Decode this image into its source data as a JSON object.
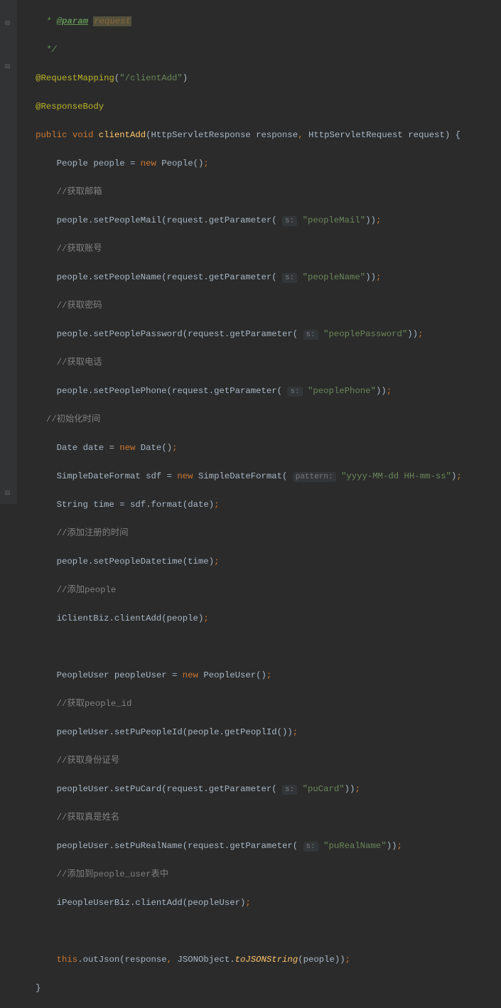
{
  "code": {
    "doc_star": " * ",
    "doc_param_tag": "@param",
    "doc_param_name": "request",
    "doc_close": " */",
    "ann_reqmap": "@RequestMapping",
    "ann_reqmap_val": "\"/clientAdd\"",
    "ann_respbody": "@ResponseBody",
    "kw_public": "public",
    "kw_void": "void",
    "kw_new": "new",
    "kw_this": "this",
    "fn_clientAdd": "clientAdd",
    "type_HttpServletResponse": "HttpServletResponse",
    "var_response": "response",
    "type_HttpServletRequest": "HttpServletRequest",
    "var_request": "request",
    "type_People": "People",
    "var_people": "people",
    "cm_mail": "//获取邮箱",
    "m_setPeopleMail": "setPeopleMail",
    "m_getParameter": "getParameter",
    "hint_s": "s:",
    "str_peopleMail": "\"peopleMail\"",
    "cm_name": "//获取账号",
    "m_setPeopleName": "setPeopleName",
    "str_peopleName": "\"peopleName\"",
    "cm_pwd": "//获取密码",
    "m_setPeoplePassword": "setPeoplePassword",
    "str_peoplePassword": "\"peoplePassword\"",
    "cm_phone": "//获取电话",
    "m_setPeoplePhone": "setPeoplePhone",
    "str_peoplePhone": "\"peoplePhone\"",
    "cm_inittime": "//初始化时间",
    "type_Date": "Date",
    "var_date": "date",
    "type_SimpleDateFormat": "SimpleDateFormat",
    "var_sdf": "sdf",
    "hint_pattern": "pattern:",
    "str_pattern": "\"yyyy-MM-dd HH-mm-ss\"",
    "type_String": "String",
    "var_time": "time",
    "m_format": "format",
    "cm_regtime": "//添加注册的时间",
    "m_setPeopleDatetime": "setPeopleDatetime",
    "cm_addpeople": "//添加people",
    "var_iClientBiz": "iClientBiz",
    "m_clientAdd": "clientAdd",
    "type_PeopleUser": "PeopleUser",
    "var_peopleUser": "peopleUser",
    "cm_peopleid": "//获取people_id",
    "m_setPuPeopleId": "setPuPeopleId",
    "m_getPeoplId": "getPeoplId",
    "cm_idcard": "//获取身份证号",
    "m_setPuCard": "setPuCard",
    "str_puCard": "\"puCard\"",
    "cm_realname": "//获取真是姓名",
    "m_setPuRealName": "setPuRealName",
    "str_puRealName": "\"puRealName\"",
    "cm_addtable": "//添加到people_user表中",
    "var_iPeopleUserBiz": "iPeopleUserBiz",
    "m_outJson": "outJson",
    "type_JSONObject": "JSONObject",
    "m_toJSONString": "toJSONString"
  }
}
